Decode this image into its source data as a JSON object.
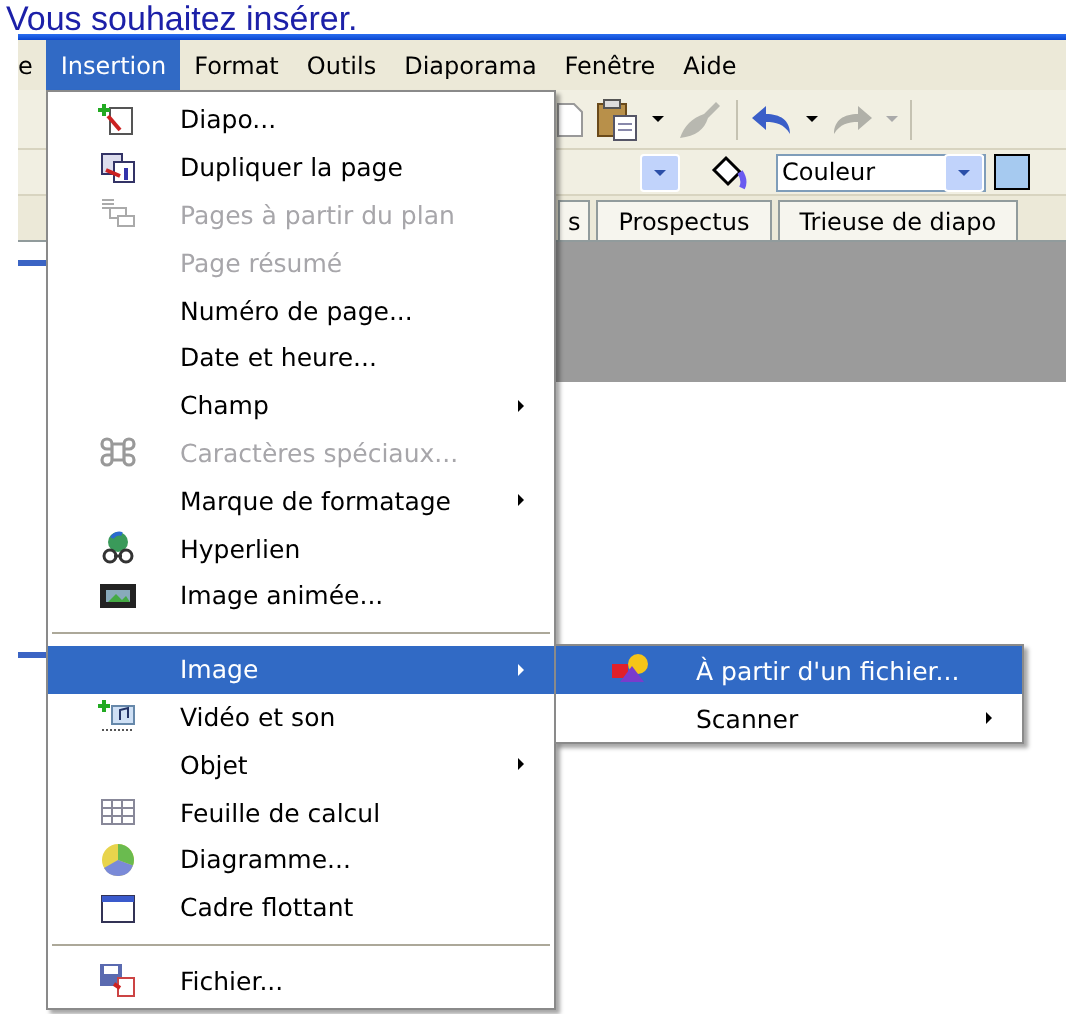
{
  "heading": "Vous souhaitez insérer.",
  "menubar": [
    {
      "label": "e",
      "selected": false
    },
    {
      "label": "Insertion",
      "selected": true
    },
    {
      "label": "Format",
      "selected": false
    },
    {
      "label": "Outils",
      "selected": false
    },
    {
      "label": "Diaporama",
      "selected": false
    },
    {
      "label": "Fenêtre",
      "selected": false
    },
    {
      "label": "Aide",
      "selected": false
    }
  ],
  "toolbar": {
    "color_field": {
      "value": "Couleur"
    }
  },
  "tabs": [
    {
      "label": "s",
      "selected": false
    },
    {
      "label": "Prospectus",
      "selected": false
    },
    {
      "label": "Trieuse de diapo",
      "selected": false
    }
  ],
  "menu": [
    {
      "kind": "item",
      "label": "Diapo...",
      "disabled": false,
      "submenu": false,
      "selected": false
    },
    {
      "kind": "item",
      "label": "Dupliquer la page",
      "disabled": false,
      "submenu": false,
      "selected": false
    },
    {
      "kind": "item",
      "label": "Pages à partir du plan",
      "disabled": true,
      "submenu": false,
      "selected": false
    },
    {
      "kind": "item",
      "label": "Page résumé",
      "disabled": true,
      "submenu": false,
      "selected": false
    },
    {
      "kind": "item",
      "label": "Numéro de page...",
      "disabled": false,
      "submenu": false,
      "selected": false
    },
    {
      "kind": "item",
      "label": "Date et heure...",
      "disabled": false,
      "submenu": false,
      "selected": false
    },
    {
      "kind": "item",
      "label": "Champ",
      "disabled": false,
      "submenu": true,
      "selected": false
    },
    {
      "kind": "item",
      "label": "Caractères spéciaux...",
      "disabled": true,
      "submenu": false,
      "selected": false
    },
    {
      "kind": "item",
      "label": "Marque de formatage",
      "disabled": false,
      "submenu": true,
      "selected": false
    },
    {
      "kind": "item",
      "label": "Hyperlien",
      "disabled": false,
      "submenu": false,
      "selected": false
    },
    {
      "kind": "item",
      "label": "Image animée...",
      "disabled": false,
      "submenu": false,
      "selected": false
    },
    {
      "kind": "separator"
    },
    {
      "kind": "item",
      "label": "Image",
      "disabled": false,
      "submenu": true,
      "selected": true
    },
    {
      "kind": "item",
      "label": "Vidéo et son",
      "disabled": false,
      "submenu": false,
      "selected": false
    },
    {
      "kind": "item",
      "label": "Objet",
      "disabled": false,
      "submenu": true,
      "selected": false
    },
    {
      "kind": "item",
      "label": "Feuille de calcul",
      "disabled": false,
      "submenu": false,
      "selected": false
    },
    {
      "kind": "item",
      "label": "Diagramme...",
      "disabled": false,
      "submenu": false,
      "selected": false
    },
    {
      "kind": "item",
      "label": "Cadre flottant",
      "disabled": false,
      "submenu": false,
      "selected": false
    },
    {
      "kind": "separator"
    },
    {
      "kind": "item",
      "label": "Fichier...",
      "disabled": false,
      "submenu": false,
      "selected": false
    }
  ],
  "submenu": [
    {
      "label": "À partir d'un fichier...",
      "submenu": false,
      "selected": true
    },
    {
      "label": "Scanner",
      "submenu": true,
      "selected": false
    }
  ]
}
